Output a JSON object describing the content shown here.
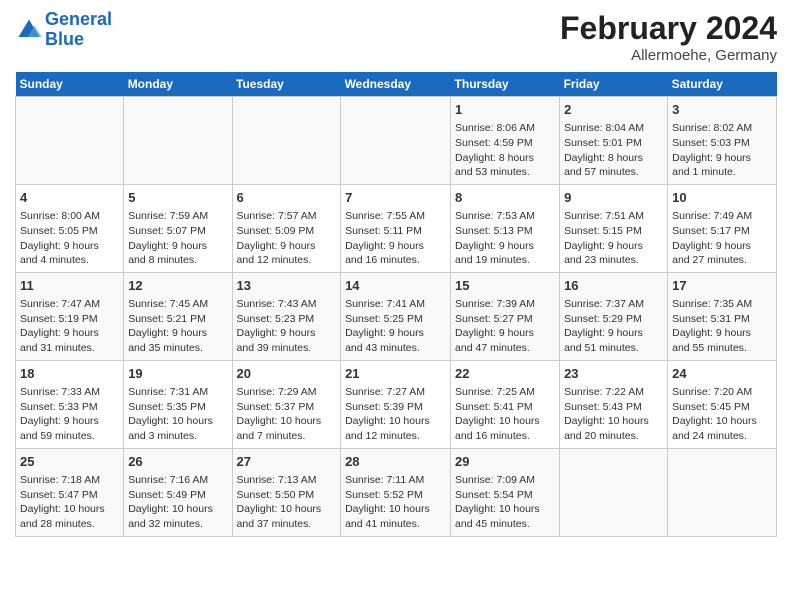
{
  "header": {
    "logo_line1": "General",
    "logo_line2": "Blue",
    "title": "February 2024",
    "subtitle": "Allermoehe, Germany"
  },
  "columns": [
    "Sunday",
    "Monday",
    "Tuesday",
    "Wednesday",
    "Thursday",
    "Friday",
    "Saturday"
  ],
  "weeks": [
    [
      {
        "day": "",
        "info": ""
      },
      {
        "day": "",
        "info": ""
      },
      {
        "day": "",
        "info": ""
      },
      {
        "day": "",
        "info": ""
      },
      {
        "day": "1",
        "info": "Sunrise: 8:06 AM\nSunset: 4:59 PM\nDaylight: 8 hours\nand 53 minutes."
      },
      {
        "day": "2",
        "info": "Sunrise: 8:04 AM\nSunset: 5:01 PM\nDaylight: 8 hours\nand 57 minutes."
      },
      {
        "day": "3",
        "info": "Sunrise: 8:02 AM\nSunset: 5:03 PM\nDaylight: 9 hours\nand 1 minute."
      }
    ],
    [
      {
        "day": "4",
        "info": "Sunrise: 8:00 AM\nSunset: 5:05 PM\nDaylight: 9 hours\nand 4 minutes."
      },
      {
        "day": "5",
        "info": "Sunrise: 7:59 AM\nSunset: 5:07 PM\nDaylight: 9 hours\nand 8 minutes."
      },
      {
        "day": "6",
        "info": "Sunrise: 7:57 AM\nSunset: 5:09 PM\nDaylight: 9 hours\nand 12 minutes."
      },
      {
        "day": "7",
        "info": "Sunrise: 7:55 AM\nSunset: 5:11 PM\nDaylight: 9 hours\nand 16 minutes."
      },
      {
        "day": "8",
        "info": "Sunrise: 7:53 AM\nSunset: 5:13 PM\nDaylight: 9 hours\nand 19 minutes."
      },
      {
        "day": "9",
        "info": "Sunrise: 7:51 AM\nSunset: 5:15 PM\nDaylight: 9 hours\nand 23 minutes."
      },
      {
        "day": "10",
        "info": "Sunrise: 7:49 AM\nSunset: 5:17 PM\nDaylight: 9 hours\nand 27 minutes."
      }
    ],
    [
      {
        "day": "11",
        "info": "Sunrise: 7:47 AM\nSunset: 5:19 PM\nDaylight: 9 hours\nand 31 minutes."
      },
      {
        "day": "12",
        "info": "Sunrise: 7:45 AM\nSunset: 5:21 PM\nDaylight: 9 hours\nand 35 minutes."
      },
      {
        "day": "13",
        "info": "Sunrise: 7:43 AM\nSunset: 5:23 PM\nDaylight: 9 hours\nand 39 minutes."
      },
      {
        "day": "14",
        "info": "Sunrise: 7:41 AM\nSunset: 5:25 PM\nDaylight: 9 hours\nand 43 minutes."
      },
      {
        "day": "15",
        "info": "Sunrise: 7:39 AM\nSunset: 5:27 PM\nDaylight: 9 hours\nand 47 minutes."
      },
      {
        "day": "16",
        "info": "Sunrise: 7:37 AM\nSunset: 5:29 PM\nDaylight: 9 hours\nand 51 minutes."
      },
      {
        "day": "17",
        "info": "Sunrise: 7:35 AM\nSunset: 5:31 PM\nDaylight: 9 hours\nand 55 minutes."
      }
    ],
    [
      {
        "day": "18",
        "info": "Sunrise: 7:33 AM\nSunset: 5:33 PM\nDaylight: 9 hours\nand 59 minutes."
      },
      {
        "day": "19",
        "info": "Sunrise: 7:31 AM\nSunset: 5:35 PM\nDaylight: 10 hours\nand 3 minutes."
      },
      {
        "day": "20",
        "info": "Sunrise: 7:29 AM\nSunset: 5:37 PM\nDaylight: 10 hours\nand 7 minutes."
      },
      {
        "day": "21",
        "info": "Sunrise: 7:27 AM\nSunset: 5:39 PM\nDaylight: 10 hours\nand 12 minutes."
      },
      {
        "day": "22",
        "info": "Sunrise: 7:25 AM\nSunset: 5:41 PM\nDaylight: 10 hours\nand 16 minutes."
      },
      {
        "day": "23",
        "info": "Sunrise: 7:22 AM\nSunset: 5:43 PM\nDaylight: 10 hours\nand 20 minutes."
      },
      {
        "day": "24",
        "info": "Sunrise: 7:20 AM\nSunset: 5:45 PM\nDaylight: 10 hours\nand 24 minutes."
      }
    ],
    [
      {
        "day": "25",
        "info": "Sunrise: 7:18 AM\nSunset: 5:47 PM\nDaylight: 10 hours\nand 28 minutes."
      },
      {
        "day": "26",
        "info": "Sunrise: 7:16 AM\nSunset: 5:49 PM\nDaylight: 10 hours\nand 32 minutes."
      },
      {
        "day": "27",
        "info": "Sunrise: 7:13 AM\nSunset: 5:50 PM\nDaylight: 10 hours\nand 37 minutes."
      },
      {
        "day": "28",
        "info": "Sunrise: 7:11 AM\nSunset: 5:52 PM\nDaylight: 10 hours\nand 41 minutes."
      },
      {
        "day": "29",
        "info": "Sunrise: 7:09 AM\nSunset: 5:54 PM\nDaylight: 10 hours\nand 45 minutes."
      },
      {
        "day": "",
        "info": ""
      },
      {
        "day": "",
        "info": ""
      }
    ]
  ]
}
